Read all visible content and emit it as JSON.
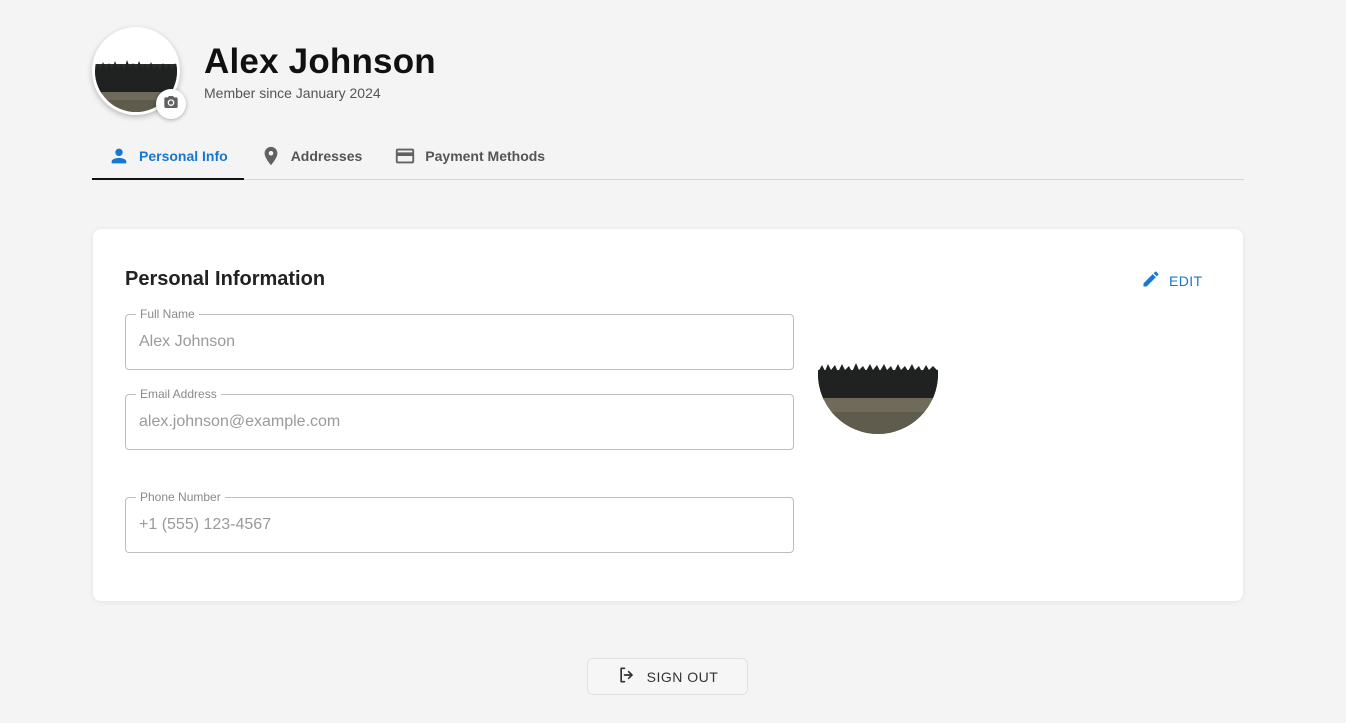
{
  "profile": {
    "name": "Alex Johnson",
    "member_since": "Member since January 2024",
    "avatar_icon": "landscape-photo",
    "camera_icon": "camera-icon"
  },
  "tabs": [
    {
      "label": "Personal Info",
      "icon": "person-icon",
      "active": true
    },
    {
      "label": "Addresses",
      "icon": "location-pin-icon",
      "active": false
    },
    {
      "label": "Payment Methods",
      "icon": "credit-card-icon",
      "active": false
    }
  ],
  "card": {
    "title": "Personal Information",
    "edit_label": "EDIT",
    "fields": [
      {
        "label": "Full Name",
        "value": "Alex Johnson"
      },
      {
        "label": "Email Address",
        "value": "alex.johnson@example.com"
      },
      {
        "label": "Phone Number",
        "value": "+1 (555) 123-4567"
      }
    ]
  },
  "footer": {
    "sign_out_label": "SIGN OUT"
  },
  "colors": {
    "accent": "#1976d2",
    "background": "#f4f4f4",
    "card": "#ffffff"
  }
}
